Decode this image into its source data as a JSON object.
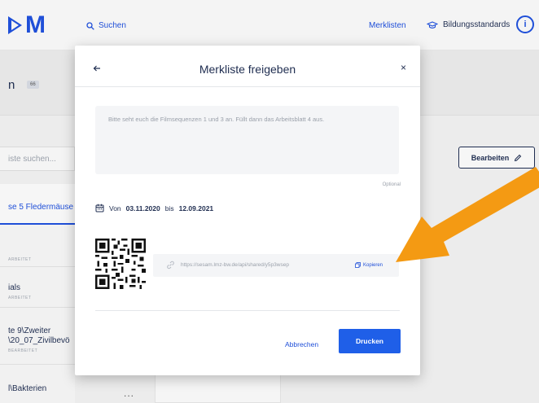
{
  "colors": {
    "accent": "#1f4fd8",
    "print_button": "#1f5fe8",
    "arrow": "#f49a13"
  },
  "header": {
    "logo": "M",
    "search_label": "Suchen",
    "merklisten_label": "Merklisten",
    "bildung_label": "Bildungsstandards",
    "info_label": "i"
  },
  "page": {
    "title_fragment": "n",
    "badge": "66",
    "search_placeholder": "iste suchen...",
    "edit_label": "Bearbeiten",
    "items": [
      {
        "title": "se 5 Fledermäuse",
        "sub": ""
      },
      {
        "title": "",
        "sub": "ARBEITET"
      },
      {
        "title": "ials",
        "sub": "ARBEITET"
      },
      {
        "title": "te 9\\Zweiter",
        "title2": "\\20_07_Zivilbevö",
        "sub": "BEARBEITET"
      },
      {
        "title": "l\\Bakterien",
        "sub": ""
      }
    ],
    "more": "..."
  },
  "modal": {
    "back_icon": "arrow-left-icon",
    "title": "Merkliste freigeben",
    "close": "×",
    "message": "Bitte seht euch die Filmsequenzen 1 und 3 an. Füllt dann das Arbeitsblatt 4 aus.",
    "optional": "Optional",
    "date_prefix": "Von",
    "date_from": "03.11.2020",
    "date_mid": "bis",
    "date_to": "12.09.2021",
    "url": "https://sesam.lmz-bw.de/api/shared/y5p3wsep",
    "copy_label": "Kopieren",
    "cancel_label": "Abbrechen",
    "print_label": "Drucken"
  }
}
